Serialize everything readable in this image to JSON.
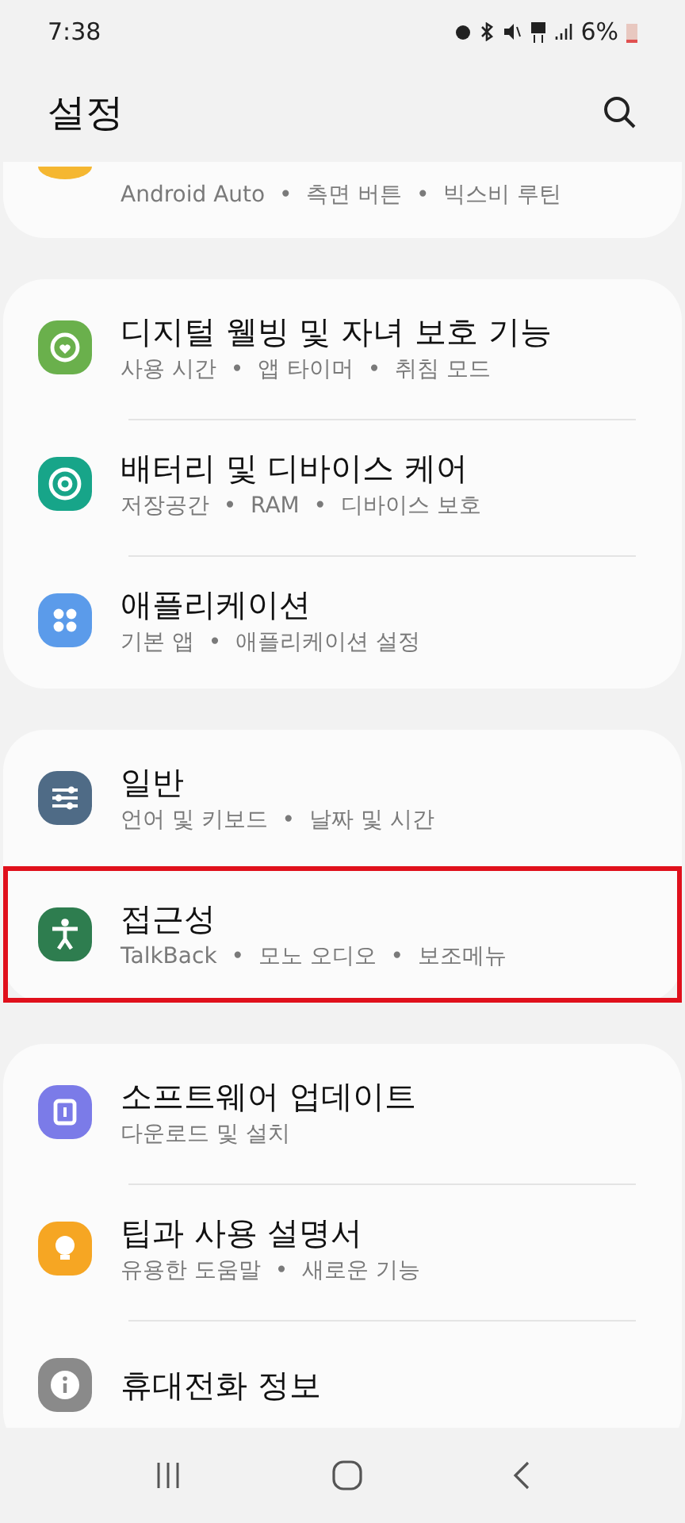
{
  "status_bar": {
    "time": "7:38",
    "battery": "6%"
  },
  "header": {
    "title": "설정"
  },
  "sections": [
    {
      "items": [
        {
          "kind": "advanced",
          "color": "#f5b731",
          "subtitle": "Android Auto  •  측면 버튼  •  빅스비 루틴",
          "highlighted": false
        }
      ]
    },
    {
      "items": [
        {
          "kind": "wellbeing",
          "color": "#6ab04c",
          "title": "디지털 웰빙 및 자녀 보호 기능",
          "subtitle": "사용 시간  •  앱 타이머  •  취침 모드",
          "highlighted": false
        },
        {
          "kind": "care",
          "color": "#17a589",
          "title": "배터리 및 디바이스 케어",
          "subtitle": "저장공간  •  RAM  •  디바이스 보호",
          "highlighted": false
        },
        {
          "kind": "apps",
          "color": "#5b9bea",
          "title": "애플리케이션",
          "subtitle": "기본 앱  •  애플리케이션 설정",
          "highlighted": false
        }
      ]
    },
    {
      "items": [
        {
          "kind": "general",
          "color": "#4f6b86",
          "title": "일반",
          "subtitle": "언어 및 키보드  •  날짜 및 시간",
          "highlighted": false
        },
        {
          "kind": "accessibility",
          "color": "#2e7d4f",
          "title": "접근성",
          "subtitle": "TalkBack  •  모노 오디오  •  보조메뉴",
          "highlighted": true
        }
      ]
    },
    {
      "items": [
        {
          "kind": "update",
          "color": "#7b7be8",
          "title": "소프트웨어 업데이트",
          "subtitle": "다운로드 및 설치",
          "highlighted": false
        },
        {
          "kind": "tips",
          "color": "#f6a623",
          "title": "팁과 사용 설명서",
          "subtitle": "유용한 도움말  •  새로운 기능",
          "highlighted": false
        },
        {
          "kind": "about",
          "color": "#8a8a8a",
          "title": "휴대전화 정보",
          "highlighted": false
        }
      ]
    }
  ]
}
